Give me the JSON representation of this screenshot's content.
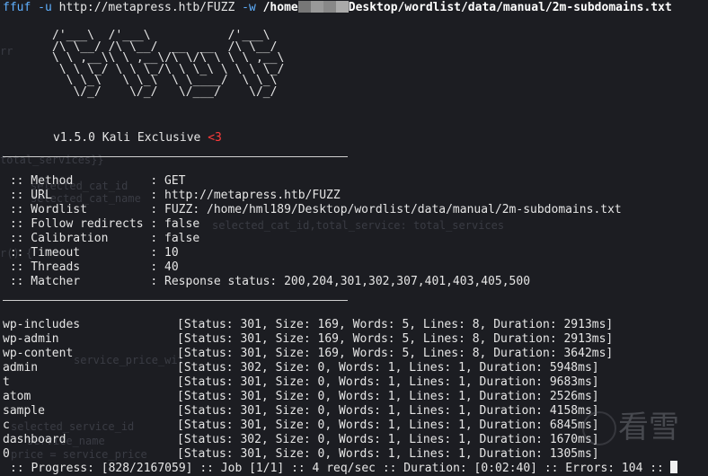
{
  "command": {
    "prog": "ffuf",
    "flag_u": "-u",
    "url": "http://metapress.htb/FUZZ",
    "flag_w": "-w",
    "path_prefix": "/home",
    "path_suffix": "Desktop/wordlist/data/manual/2m-subdomains.txt"
  },
  "banner": {
    "art": "/'___\\  /'___\\           /'___\\\n/\\ \\__/ /\\ \\__/  __  __  /\\ \\__/\n\\ \\ ,__\\\\ \\ ,__\\/\\ \\/\\ \\ \\ \\ ,__\\\n \\ \\ \\_/ \\ \\ \\_/\\ \\ \\_\\ \\ \\ \\ \\_/\n  \\ \\_\\   \\ \\_\\  \\ \\____/  \\ \\_\\\n   \\/_/    \\/_/   \\/___/    \\/_/",
    "version": "v1.5.0 Kali Exclusive",
    "heart": "<3"
  },
  "config": [
    {
      "key": " :: Method           ",
      "value": ": GET"
    },
    {
      "key": " :: URL              ",
      "value": ": http://metapress.htb/FUZZ"
    },
    {
      "key": " :: Wordlist         ",
      "value": ": FUZZ: /home/hml189/Desktop/wordlist/data/manual/2m-subdomains.txt"
    },
    {
      "key": " :: Follow redirects ",
      "value": ": false"
    },
    {
      "key": " :: Calibration      ",
      "value": ": false"
    },
    {
      "key": " :: Timeout          ",
      "value": ": 10"
    },
    {
      "key": " :: Threads          ",
      "value": ": 40"
    },
    {
      "key": " :: Matcher          ",
      "value": ": Response status: 200,204,301,302,307,401,403,405,500"
    }
  ],
  "results": [
    {
      "word": "wp-includes",
      "info": "[Status: 301, Size: 169, Words: 5, Lines: 8, Duration: 2913ms]"
    },
    {
      "word": "wp-admin",
      "info": "[Status: 301, Size: 169, Words: 5, Lines: 8, Duration: 2913ms]"
    },
    {
      "word": "wp-content",
      "info": "[Status: 301, Size: 169, Words: 5, Lines: 8, Duration: 3642ms]"
    },
    {
      "word": "admin",
      "info": "[Status: 302, Size: 0, Words: 1, Lines: 1, Duration: 5948ms]"
    },
    {
      "word": "t",
      "info": "[Status: 301, Size: 0, Words: 1, Lines: 1, Duration: 9683ms]"
    },
    {
      "word": "atom",
      "info": "[Status: 301, Size: 0, Words: 1, Lines: 1, Duration: 2526ms]"
    },
    {
      "word": "sample",
      "info": "[Status: 301, Size: 0, Words: 1, Lines: 1, Duration: 4158ms]"
    },
    {
      "word": "c",
      "info": "[Status: 301, Size: 0, Words: 1, Lines: 1, Duration: 6845ms]"
    },
    {
      "word": "dashboard",
      "info": "[Status: 302, Size: 0, Words: 1, Lines: 1, Duration: 1670ms]"
    },
    {
      "word": "0",
      "info": "[Status: 301, Size: 0, Words: 1, Lines: 1, Duration: 1305ms]"
    }
  ],
  "progress": {
    "text": ":: Progress: [828/2167059] :: Job [1/1] :: 4 req/sec :: Duration: [0:02:40] :: Errors: 104 ::"
  },
  "watermark": {
    "text": "看雪"
  },
  "ghost_text": [
    "rr",
    "total_services}}",
    "selected_cat_id",
    "selected_cat_name",
    "selected_cat_id,total_service: total_services",
    "r() {",
    "service_price_wit",
    "selected_service_id",
    "service_name",
    "price = service_price"
  ],
  "colors": {
    "background": "#1c1d22",
    "accent": "#5fb0ff",
    "heart": "#ff3b3b"
  }
}
